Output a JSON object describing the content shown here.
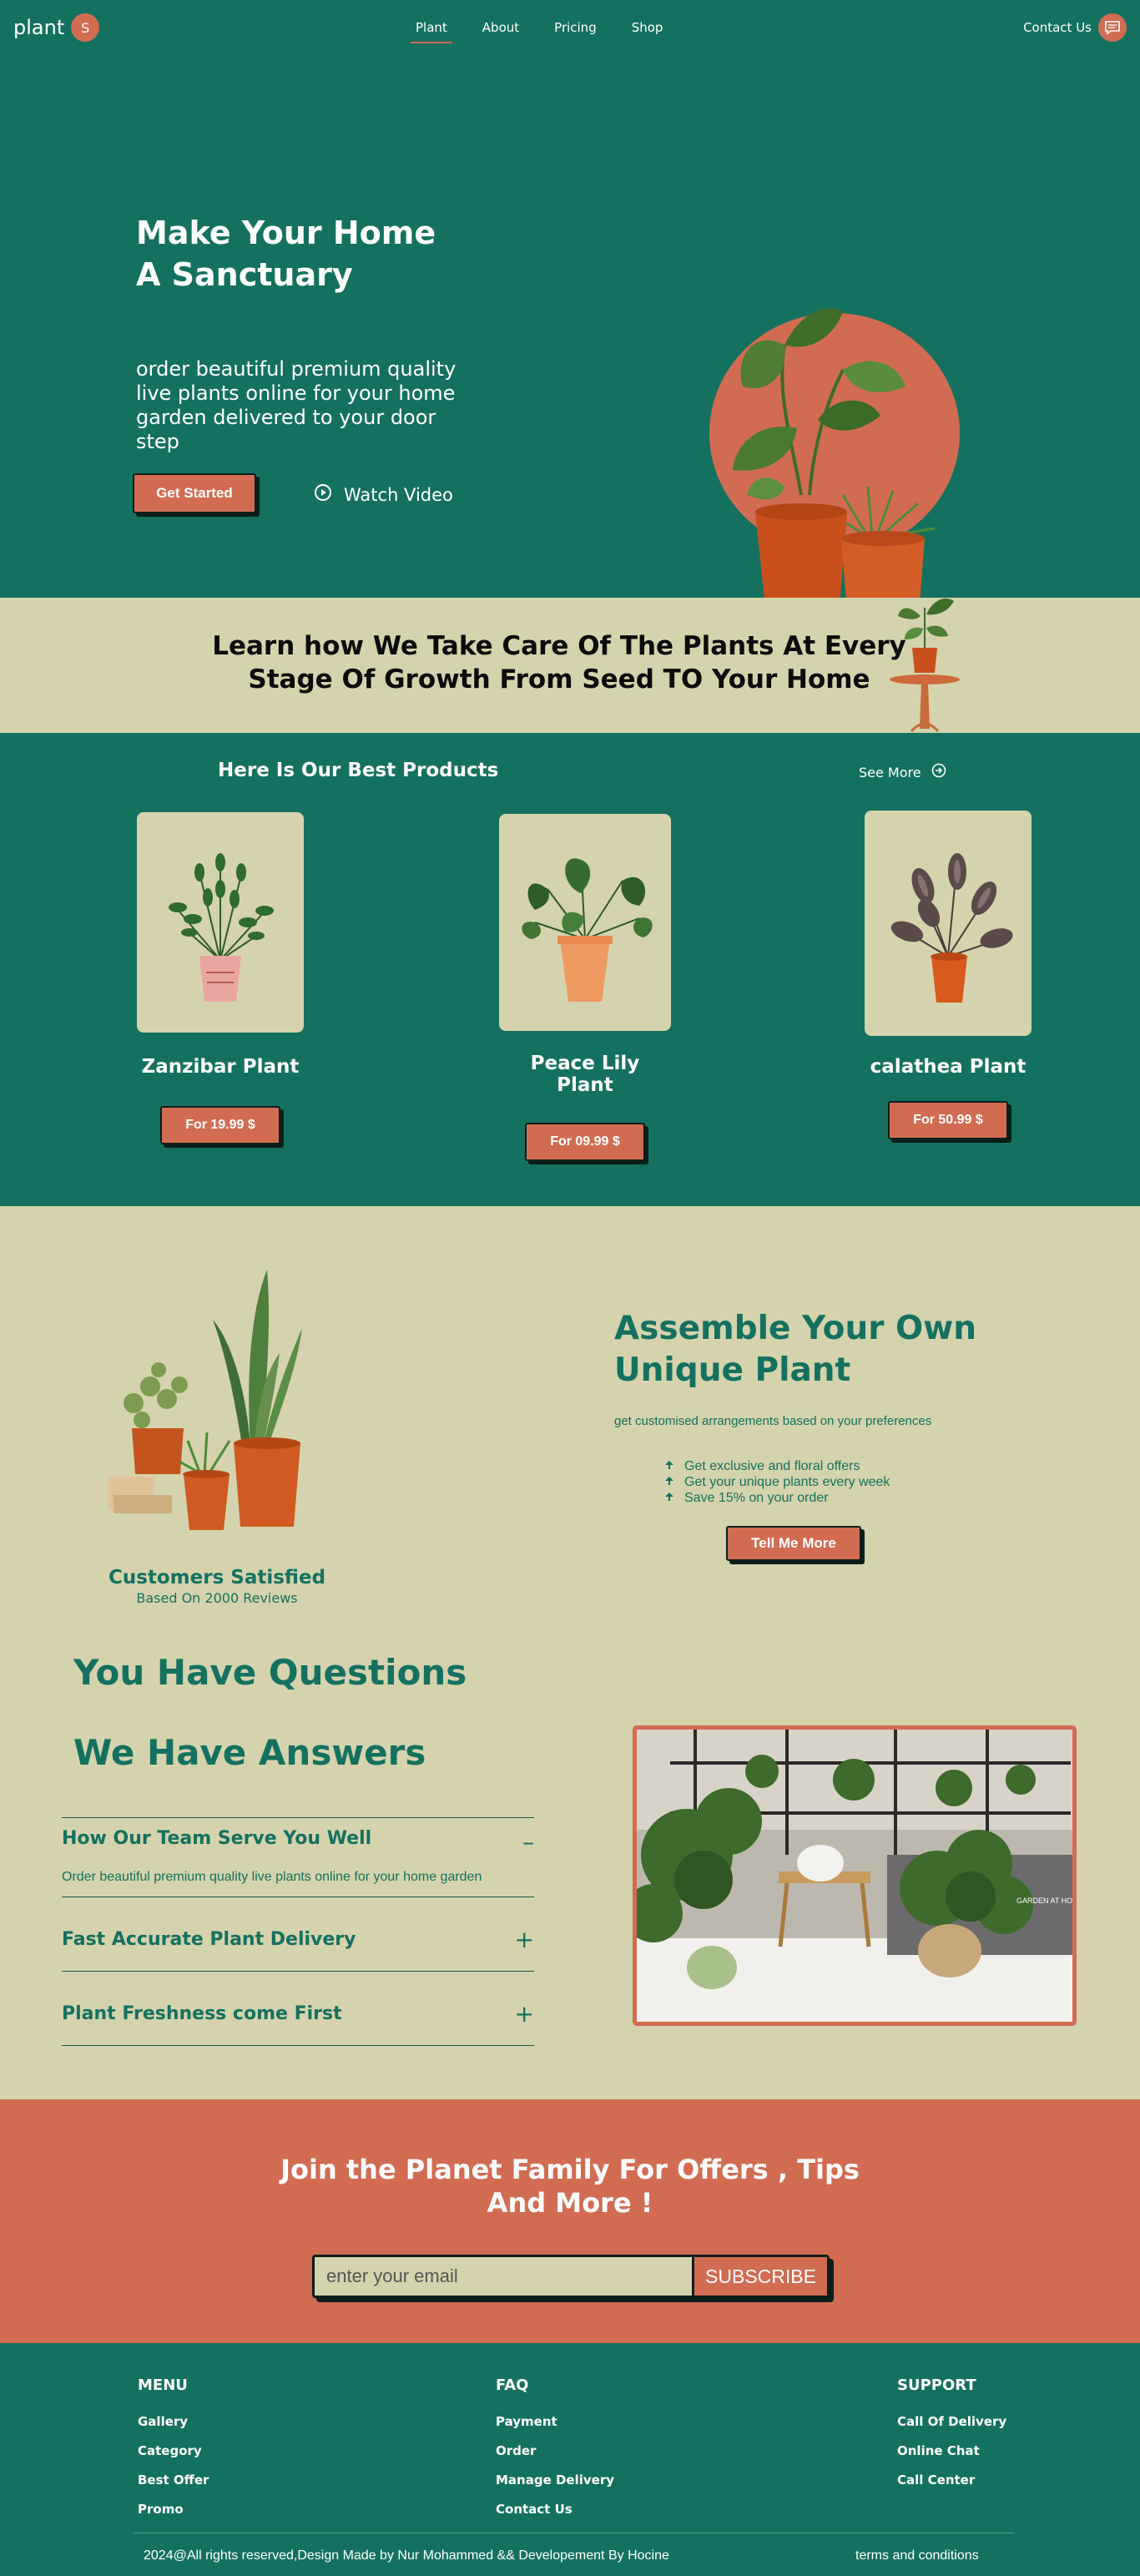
{
  "colors": {
    "teal": "#15715f",
    "beige": "#d4d3ad",
    "coral": "#d16c53"
  },
  "nav": {
    "logo_text": "plant",
    "logo_badge": "S",
    "links": [
      "Plant",
      "About",
      "Pricing",
      "Shop"
    ],
    "active_link": "Plant",
    "contact_label": "Contact Us",
    "contact_icon": "chat-icon"
  },
  "hero": {
    "title_line1": "Make Your Home",
    "title_line2": "A Sanctuary",
    "subtitle": "order beautiful premium quality live plants online for your home garden delivered to your door step",
    "cta_label": "Get Started",
    "watch_label": "Watch Video",
    "watch_icon": "play-circle-icon"
  },
  "band": {
    "text": "Learn how We Take Care Of The Plants At Every Stage Of Growth From Seed TO Your Home"
  },
  "products": {
    "title": "Here Is Our Best Products",
    "see_more": "See More",
    "see_more_icon": "arrow-right-circle-icon",
    "items": [
      {
        "name": "Zanzibar Plant",
        "price_label": "For 19.99 $"
      },
      {
        "name": "Peace Lily Plant",
        "price_label": "For 09.99 $"
      },
      {
        "name": "calathea Plant",
        "price_label": "For 50.99 $"
      }
    ]
  },
  "assemble": {
    "title": "Assemble Your Own Unique Plant",
    "description": "get customised arrangements based on your preferences",
    "features": [
      "Get exclusive and floral offers",
      "Get your unique plants every week",
      "Save 15% on your order"
    ],
    "feature_icon": "leaf-icon",
    "cta_label": "Tell Me More",
    "satisfied_title": "Customers Satisfied",
    "satisfied_sub": "Based On 2000 Reviews"
  },
  "faq": {
    "title1": "You Have Questions",
    "title2": "We Have Answers",
    "items": [
      {
        "question": "How Our Team Serve You Well",
        "toggle": "–",
        "answer": "Order beautiful premium quality live plants online for your home garden"
      },
      {
        "question": "Fast Accurate Plant Delivery",
        "toggle": "+"
      },
      {
        "question": "Plant Freshness come First",
        "toggle": "+"
      }
    ],
    "photo_caption": "GARDEN AT HOME"
  },
  "newsletter": {
    "title": "Join the Planet Family For Offers , Tips And More !",
    "placeholder": "enter your email",
    "button": "SUBSCRIBE"
  },
  "footer": {
    "columns": [
      {
        "heading": "MENU",
        "links": [
          "Gallery",
          "Category",
          "Best Offer",
          "Promo"
        ]
      },
      {
        "heading": "FAQ",
        "links": [
          "Payment",
          "Order",
          "Manage Delivery",
          "Contact Us"
        ]
      },
      {
        "heading": "SUPPORT",
        "links": [
          "Call Of Delivery",
          "Online Chat",
          "Call Center"
        ]
      }
    ],
    "copyright": "2024@All rights reserved,Design Made by Nur Mohammed && Developement By Hocine",
    "terms": "terms and conditions"
  }
}
